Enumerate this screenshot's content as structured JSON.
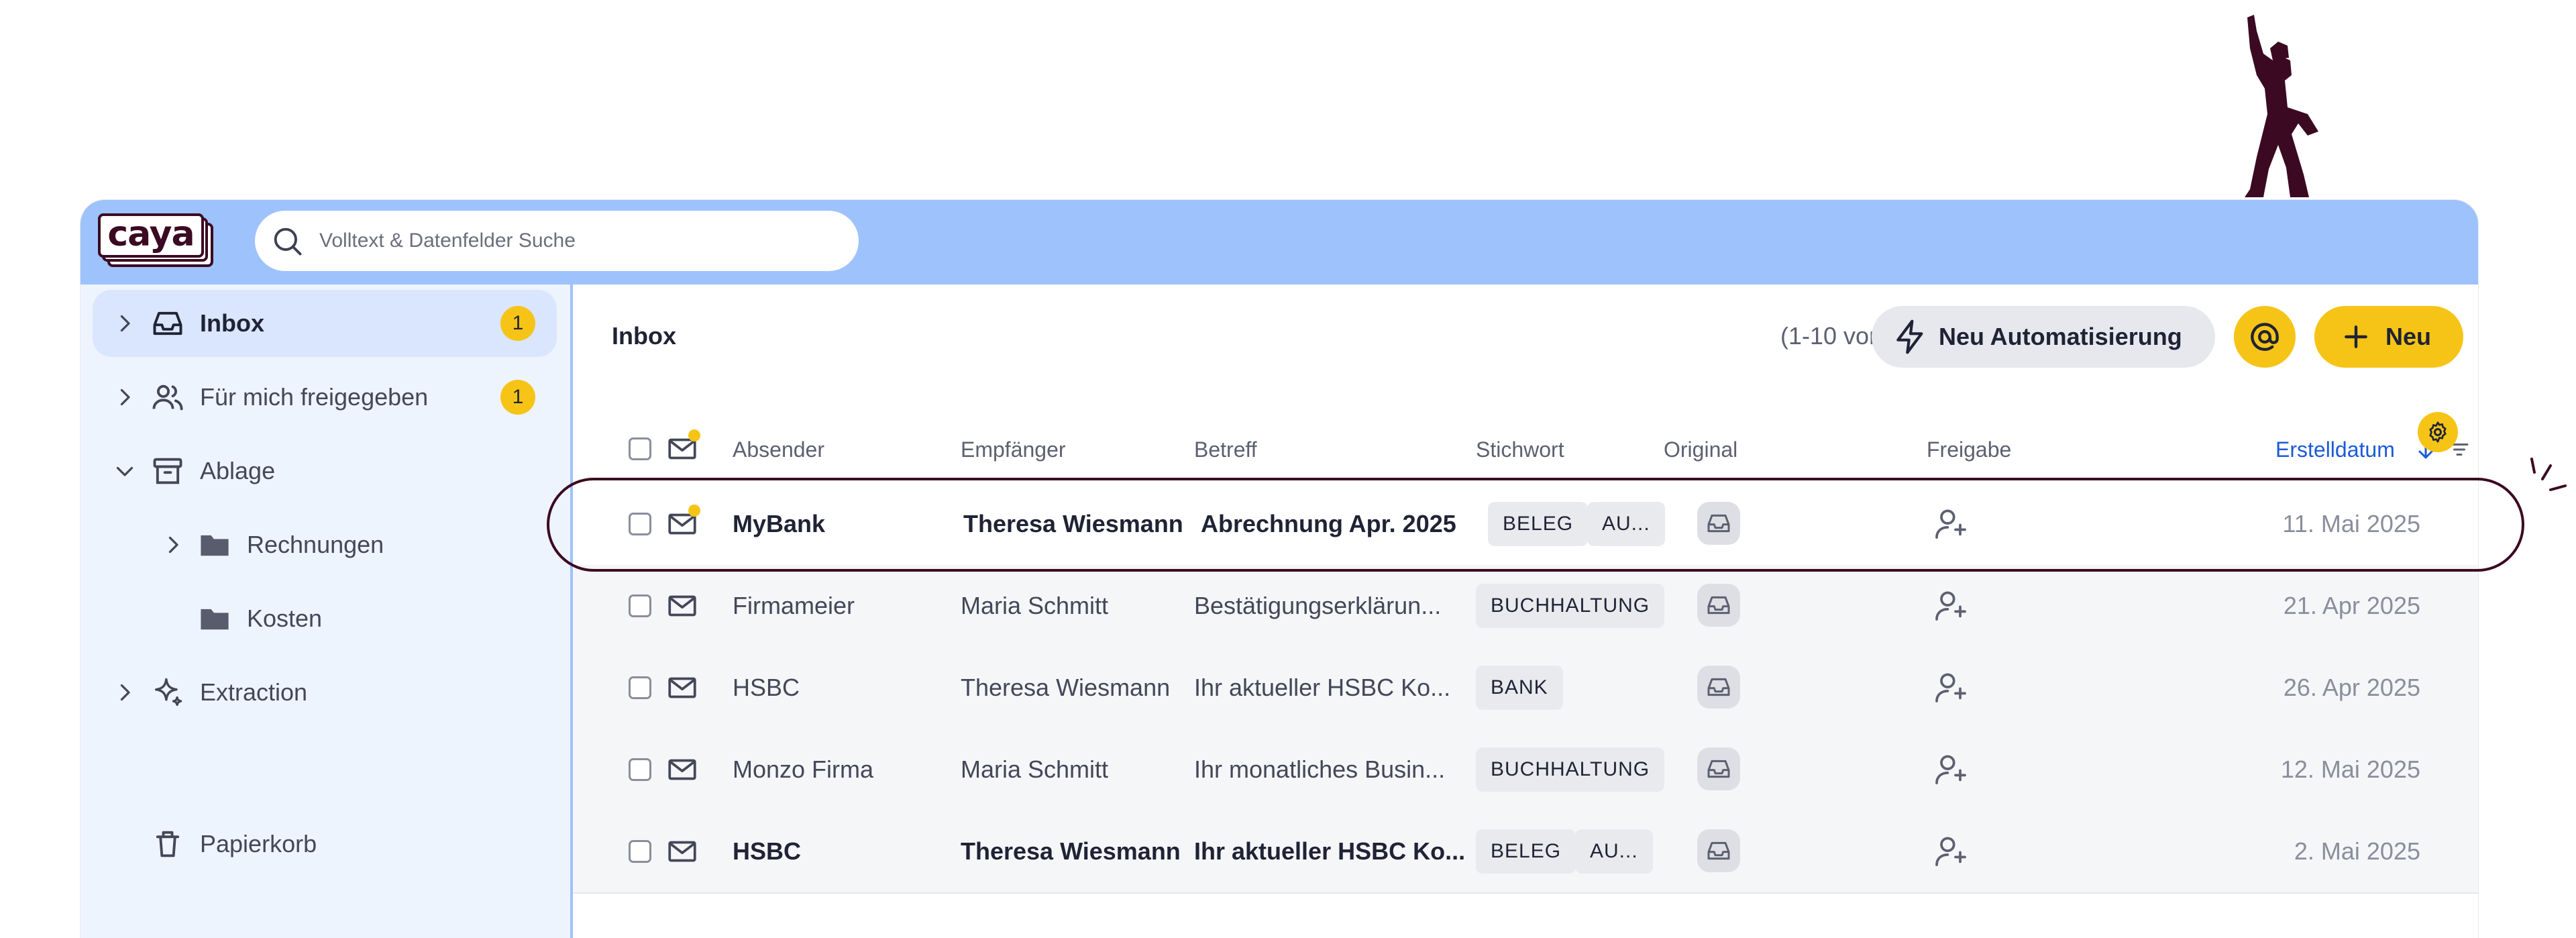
{
  "brand": {
    "logo_text": "caya",
    "accent": "#f6c416",
    "topbar_color": "#9ec2fb",
    "ink": "#3b0a22"
  },
  "search": {
    "placeholder": "Volltext & Datenfelder Suche",
    "icon": "search-icon"
  },
  "sidebar": {
    "items": [
      {
        "label": "Inbox",
        "icon": "inbox-icon",
        "badge": "1",
        "active": true,
        "chevron": "right"
      },
      {
        "label": "Für mich freigegeben",
        "icon": "users-icon",
        "badge": "1",
        "chevron": "right"
      },
      {
        "label": "Ablage",
        "icon": "archive-icon",
        "chevron": "down"
      },
      {
        "label": "Rechnungen",
        "icon": "folder-icon",
        "chevron": "right"
      },
      {
        "label": "Kosten",
        "icon": "folder-icon"
      },
      {
        "label": "Extraction",
        "icon": "sparkle-icon",
        "chevron": "right"
      },
      {
        "label": "Papierkorb",
        "icon": "trash-icon"
      }
    ]
  },
  "main": {
    "title": "Inbox",
    "count": "(1-10 von 10)",
    "automation_label": "Neu Automatisierung",
    "at_label": "@",
    "new_label": "Neu"
  },
  "table": {
    "headers": {
      "sender": "Absender",
      "recipient": "Empfänger",
      "subject": "Betreff",
      "keyword": "Stichwort",
      "original": "Original",
      "share": "Freigabe",
      "created": "Erstelldatum"
    },
    "rows": [
      {
        "sender": "MyBank",
        "recipient": "Theresa Wiesmann",
        "subject": "Abrechnung Apr. 2025",
        "tags": [
          "BELEG",
          "AU..."
        ],
        "date": "11. Mai 2025",
        "unread": true,
        "highlighted": true
      },
      {
        "sender": "Firmameier",
        "recipient": "Maria Schmitt",
        "subject": "Bestätigungserklärun...",
        "tags": [
          "BUCHHALTUNG"
        ],
        "date": "21. Apr 2025",
        "unread": false
      },
      {
        "sender": "HSBC",
        "recipient": "Theresa Wiesmann",
        "subject": "Ihr aktueller HSBC Ko...",
        "tags": [
          "BANK"
        ],
        "date": "26. Apr 2025",
        "unread": false
      },
      {
        "sender": "Monzo Firma",
        "recipient": "Maria Schmitt",
        "subject": "Ihr monatliches Busin...",
        "tags": [
          "BUCHHALTUNG"
        ],
        "date": "12. Mai 2025",
        "unread": false
      },
      {
        "sender": "HSBC",
        "recipient": "Theresa Wiesmann",
        "subject": "Ihr aktueller HSBC Ko...",
        "tags": [
          "BELEG",
          "AU..."
        ],
        "date": "2. Mai 2025",
        "unread": true
      }
    ]
  }
}
